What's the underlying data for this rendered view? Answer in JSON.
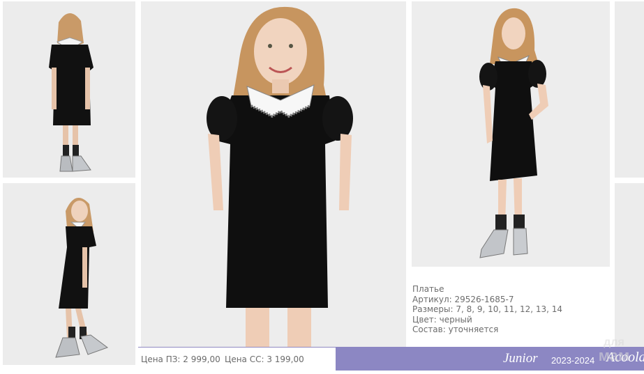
{
  "product": {
    "name": "Платье",
    "article": "Артикул: 29526-1685-7",
    "sizes": "Размеры: 7, 8, 9, 10, 11, 12, 13, 14",
    "color": "Цвет: черный",
    "composition": "Состав: уточняется"
  },
  "prices": {
    "pz": "Цена ПЗ: 2 999,00",
    "ss": "Цена СС: 3 199,00"
  },
  "brand": {
    "line": "Junior",
    "season": "2023-2024",
    "logo": "Acoola",
    "accent_color": "#8c87c3"
  },
  "watermark": {
    "line1": "для",
    "line2": "мам"
  },
  "photos": [
    {
      "view": "back",
      "icon": "model-back-photo"
    },
    {
      "view": "side",
      "icon": "model-side-photo"
    },
    {
      "view": "front-main",
      "icon": "model-front-photo"
    },
    {
      "view": "front-pose",
      "icon": "model-pose-photo"
    }
  ]
}
